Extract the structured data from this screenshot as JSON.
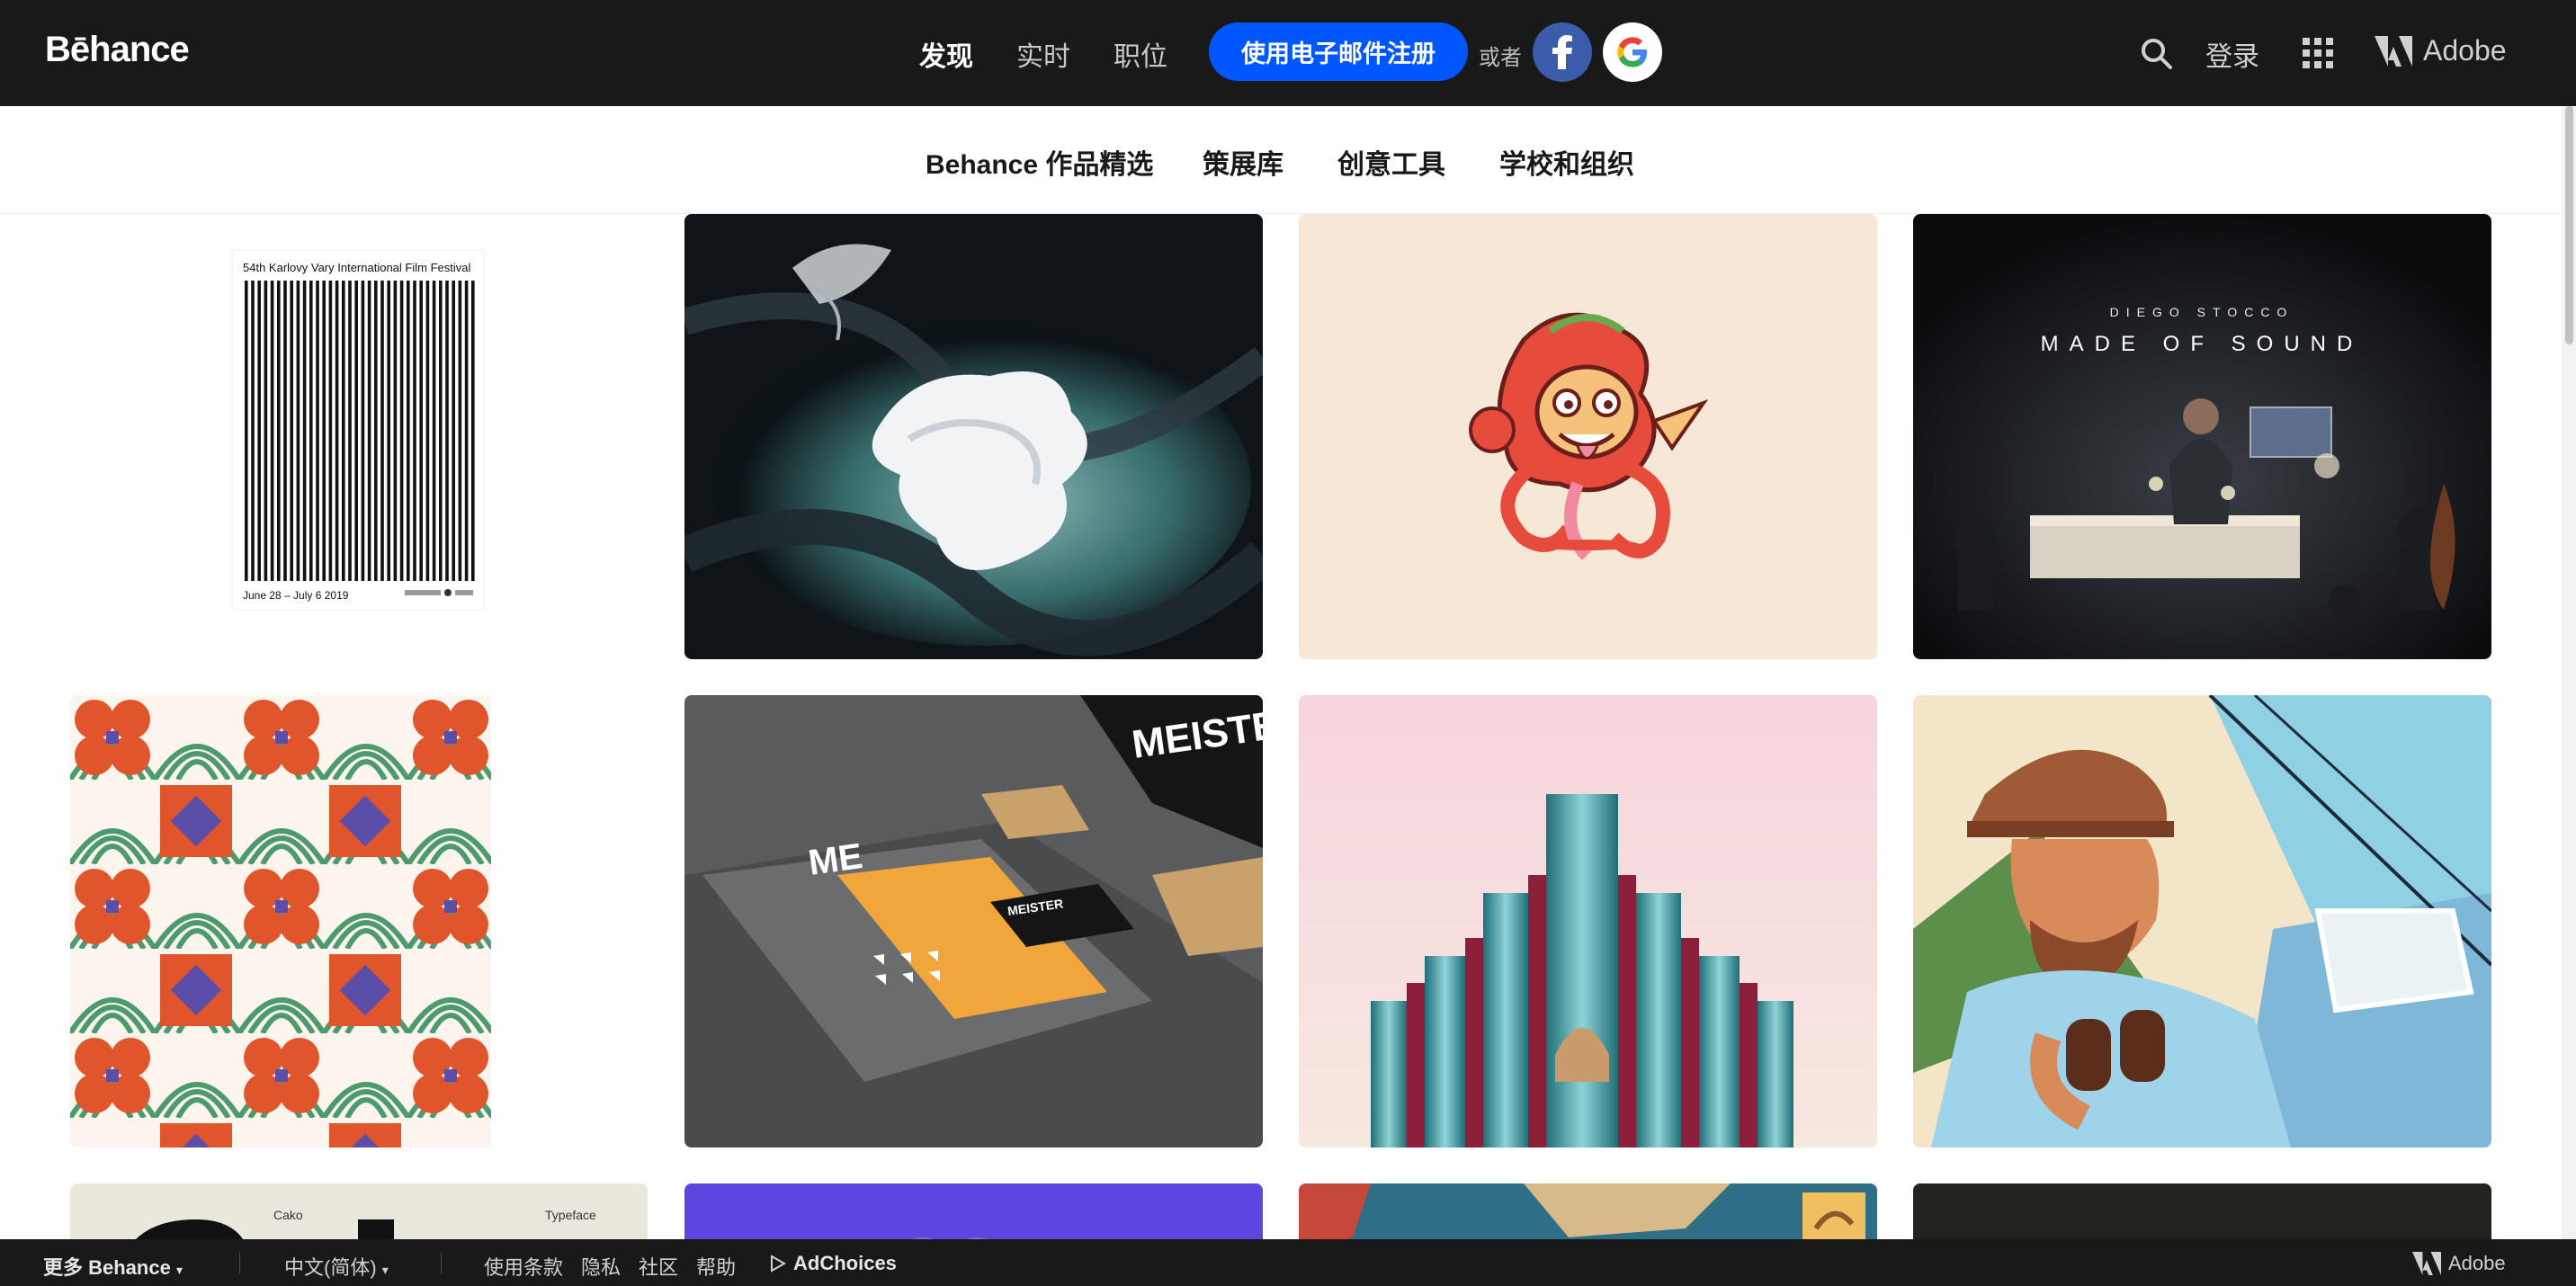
{
  "header": {
    "logo": "Bēhance",
    "nav": [
      "发现",
      "实时",
      "职位"
    ],
    "signup_label": "使用电子邮件注册",
    "or_label": "或者",
    "login_label": "登录",
    "adobe_label": "Adobe",
    "icons": [
      "facebook-icon",
      "google-icon",
      "search-icon",
      "apps-grid-icon",
      "adobe-logo-icon"
    ]
  },
  "subnav": {
    "items": [
      "Behance 作品精选",
      "策展库",
      "创意工具",
      "学校和组织"
    ]
  },
  "grid": {
    "tiles": [
      {
        "kind": "film-poster",
        "texts": [
          "54th Karlovy Vary International Film Festival",
          "June 28 – July 6 2019"
        ]
      },
      {
        "kind": "abstract-ice"
      },
      {
        "kind": "illustration-character"
      },
      {
        "kind": "music-photo",
        "texts": [
          "DIEGO STOCCO",
          "MADE OF SOUND"
        ]
      },
      {
        "kind": "pattern"
      },
      {
        "kind": "brand-mockup",
        "texts": [
          "MEISTER",
          "ME",
          "MEISTER"
        ]
      },
      {
        "kind": "architecture"
      },
      {
        "kind": "explorer-illustration"
      },
      {
        "kind": "typeface",
        "texts": [
          "Cako",
          "Typeface"
        ]
      },
      {
        "kind": "purple"
      },
      {
        "kind": "map-illustration"
      },
      {
        "kind": "dark"
      }
    ]
  },
  "footer": {
    "more_label": "更多 Behance",
    "language_label": "中文(简体)",
    "links": [
      "使用条款",
      "隐私",
      "社区",
      "帮助"
    ],
    "adchoices_label": "AdChoices",
    "adobe_label": "Adobe"
  },
  "colors": {
    "header_bg": "#191919",
    "signup_blue": "#0057ff",
    "facebook_blue": "#3b5cab"
  }
}
